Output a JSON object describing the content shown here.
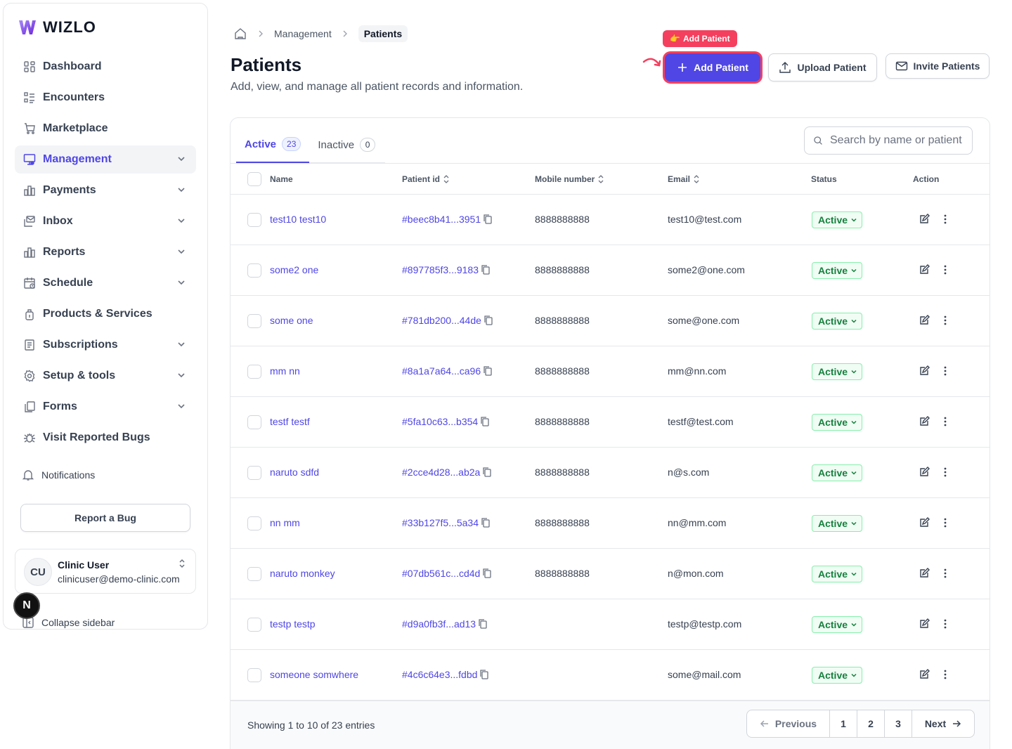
{
  "brand": {
    "name": "WIZLO"
  },
  "sidebar": {
    "items": [
      {
        "label": "Dashboard",
        "icon": "dashboard-icon",
        "expandable": false
      },
      {
        "label": "Encounters",
        "icon": "list-icon",
        "expandable": false
      },
      {
        "label": "Marketplace",
        "icon": "cart-icon",
        "expandable": false
      },
      {
        "label": "Management",
        "icon": "monitor-users-icon",
        "expandable": true,
        "active": true
      },
      {
        "label": "Payments",
        "icon": "bar-chart-icon",
        "expandable": true
      },
      {
        "label": "Inbox",
        "icon": "inbox-icon",
        "expandable": true
      },
      {
        "label": "Reports",
        "icon": "bar-chart-icon",
        "expandable": true
      },
      {
        "label": "Schedule",
        "icon": "calendar-icon",
        "expandable": true
      },
      {
        "label": "Products & Services",
        "icon": "bag-icon",
        "expandable": false
      },
      {
        "label": "Subscriptions",
        "icon": "receipt-icon",
        "expandable": true
      },
      {
        "label": "Setup & tools",
        "icon": "gear-icon",
        "expandable": true
      },
      {
        "label": "Forms",
        "icon": "copy-icon",
        "expandable": true
      },
      {
        "label": "Visit Reported Bugs",
        "icon": "bug-icon",
        "expandable": false
      }
    ],
    "notifications_label": "Notifications",
    "report_bug_label": "Report a Bug",
    "user": {
      "initials": "CU",
      "name": "Clinic User",
      "email": "clinicuser@demo-clinic.com"
    },
    "collapse_label": "Collapse sidebar",
    "n_badge": "N"
  },
  "breadcrumb": {
    "parent": "Management",
    "current": "Patients"
  },
  "header": {
    "title": "Patients",
    "subtitle": "Add, view, and manage all patient records and information.",
    "tooltip": "Add Patient",
    "add_label": "Add Patient",
    "upload_label": "Upload Patient",
    "invite_label": "Invite Patients"
  },
  "tabs": [
    {
      "label": "Active",
      "count": "23",
      "active": true
    },
    {
      "label": "Inactive",
      "count": "0",
      "active": false
    }
  ],
  "search": {
    "placeholder": "Search by name or patient id"
  },
  "table": {
    "columns": {
      "name": "Name",
      "patient_id": "Patient id",
      "mobile": "Mobile number",
      "email": "Email",
      "status": "Status",
      "action": "Action"
    },
    "rows": [
      {
        "name": "test10 test10",
        "patient_id": "#beec8b41...3951",
        "mobile": "8888888888",
        "email": "test10@test.com",
        "status": "Active"
      },
      {
        "name": "some2 one",
        "patient_id": "#897785f3...9183",
        "mobile": "8888888888",
        "email": "some2@one.com",
        "status": "Active"
      },
      {
        "name": "some one",
        "patient_id": "#781db200...44de",
        "mobile": "8888888888",
        "email": "some@one.com",
        "status": "Active"
      },
      {
        "name": "mm nn",
        "patient_id": "#8a1a7a64...ca96",
        "mobile": "8888888888",
        "email": "mm@nn.com",
        "status": "Active"
      },
      {
        "name": "testf testf",
        "patient_id": "#5fa10c63...b354",
        "mobile": "8888888888",
        "email": "testf@test.com",
        "status": "Active"
      },
      {
        "name": "naruto sdfd",
        "patient_id": "#2cce4d28...ab2a",
        "mobile": "8888888888",
        "email": "n@s.com",
        "status": "Active"
      },
      {
        "name": "nn mm",
        "patient_id": "#33b127f5...5a34",
        "mobile": "8888888888",
        "email": "nn@mm.com",
        "status": "Active"
      },
      {
        "name": "naruto monkey",
        "patient_id": "#07db561c...cd4d",
        "mobile": "8888888888",
        "email": "n@mon.com",
        "status": "Active"
      },
      {
        "name": "testp testp",
        "patient_id": "#d9a0fb3f...ad13",
        "mobile": "",
        "email": "testp@testp.com",
        "status": "Active"
      },
      {
        "name": "someone somwhere",
        "patient_id": "#4c6c64e3...fdbd",
        "mobile": "",
        "email": "some@mail.com",
        "status": "Active"
      }
    ]
  },
  "footer": {
    "showing": "Showing 1 to 10 of 23 entries",
    "previous_label": "Previous",
    "pages": [
      "1",
      "2",
      "3"
    ],
    "next_label": "Next"
  },
  "colors": {
    "accent": "#4f46e5",
    "highlight": "#f43f5e",
    "status_green": "#15803d"
  }
}
